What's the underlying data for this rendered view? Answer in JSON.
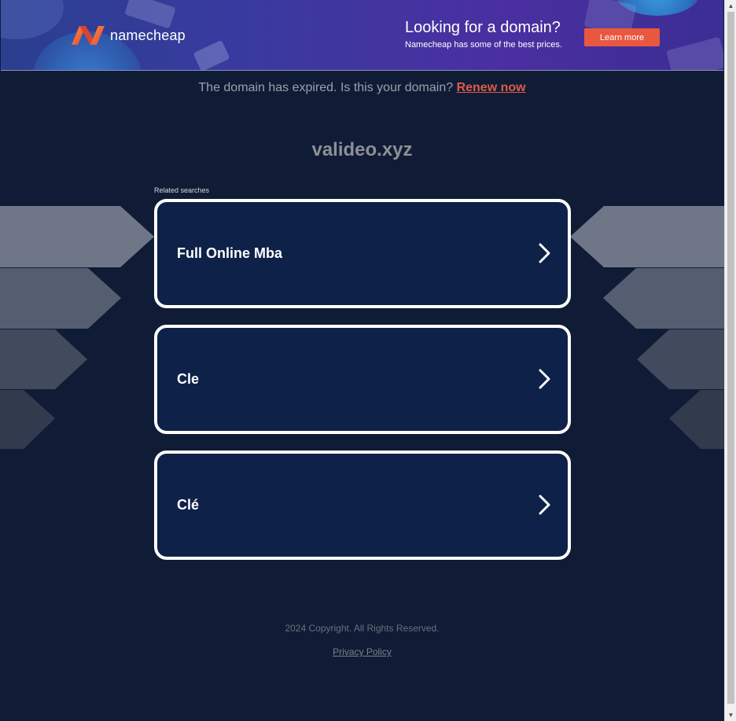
{
  "banner": {
    "brand": "namecheap",
    "title": "Looking for a domain?",
    "subtitle": "Namecheap has some of the best prices.",
    "button_label": "Learn more",
    "accent": "#e9573f"
  },
  "notice": {
    "text": "The domain has expired. Is this your domain?",
    "link_label": "Renew now",
    "link_color": "#e05a47"
  },
  "domain_name": "valideo.xyz",
  "related": {
    "heading": "Related searches",
    "items": [
      {
        "label": "Full Online Mba",
        "icon": "chevron-right-icon"
      },
      {
        "label": "Cle",
        "icon": "chevron-right-icon"
      },
      {
        "label": "Clé",
        "icon": "chevron-right-icon"
      }
    ]
  },
  "footer": {
    "copyright": "2024 Copyright. All Rights Reserved.",
    "privacy_label": "Privacy Policy"
  },
  "scrollbar": {
    "up_icon": "scroll-up-arrow-icon",
    "down_icon": "scroll-down-arrow-icon"
  }
}
